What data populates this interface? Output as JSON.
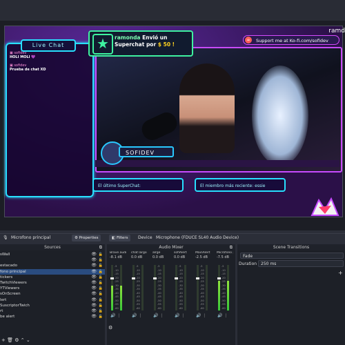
{
  "preview": {
    "top_right_text": "ramd",
    "live_chat_title": "Live Chat",
    "chat_messages": [
      {
        "user": "sofidev",
        "text": "HOLI MOLI 💜"
      },
      {
        "user": "sofidev",
        "text": "Prueba de chat XD"
      }
    ],
    "superchat": {
      "user": "ramonda",
      "line1_suffix": " Envió un",
      "line2_prefix": "Superchat por ",
      "amount": "$ 50 !"
    },
    "kofi_text": "Support me at Ko-fi.com/sofidev",
    "name_tag": "SOFIDEV",
    "last_superchat_label": "El último SuperChat:",
    "last_member_label": "El miembro más reciente: essie"
  },
  "source_toolbar": {
    "source_name": "Microfono principal",
    "properties_label": "Properties",
    "filters_label": "Filters",
    "device_label": "Device",
    "device_value": "Microphone (FDUCE SL40 Audio Device)"
  },
  "sources": {
    "title": "Sources",
    "items": [
      {
        "label": "sWall",
        "selected": false
      },
      {
        "label": "",
        "selected": false
      },
      {
        "label": "estacado",
        "selected": false
      },
      {
        "label": "fono principal",
        "selected": true
      },
      {
        "label": "tickers",
        "selected": false
      },
      {
        "label": "TwitchViewers",
        "selected": false
      },
      {
        "label": "YTViewers",
        "selected": false
      },
      {
        "label": "sOnScreen",
        "selected": false
      },
      {
        "label": "lert",
        "selected": false
      },
      {
        "label": "SuscriptorTwich",
        "selected": false
      },
      {
        "label": "rt",
        "selected": false
      },
      {
        "label": "be alert",
        "selected": false
      }
    ]
  },
  "audio_mixer": {
    "title": "Audio Mixer",
    "channels": [
      {
        "name": "Brave audio",
        "db": "-8.1 dB",
        "level": 0.55
      },
      {
        "name": "chat largo",
        "db": "0.0 dB",
        "level": 0.0
      },
      {
        "name": "alrge",
        "db": "0.0 dB",
        "level": 0.0
      },
      {
        "name": "sofiAlert",
        "db": "0.0 dB",
        "level": 0.0
      },
      {
        "name": "MainAlert",
        "db": "-2.5 dB",
        "level": 0.0
      },
      {
        "name": "Micrófono pri",
        "db": "-7.5 dB",
        "level": 0.65
      }
    ],
    "scale": [
      "-5",
      "-10",
      "-15",
      "-20",
      "-25",
      "-30",
      "-35",
      "-40",
      "-45",
      "-50",
      "-55",
      "-60"
    ]
  },
  "scene_transitions": {
    "title": "Scene Transitions",
    "transition": "Fade",
    "duration_label": "Duration",
    "duration_value": "250 ms"
  },
  "colors": {
    "accent_cyan": "#28e0ff",
    "accent_purple": "#c84bff",
    "accent_green": "#3ef2a0",
    "selected_row": "#2a4c80",
    "meter_green": "#38c838"
  }
}
